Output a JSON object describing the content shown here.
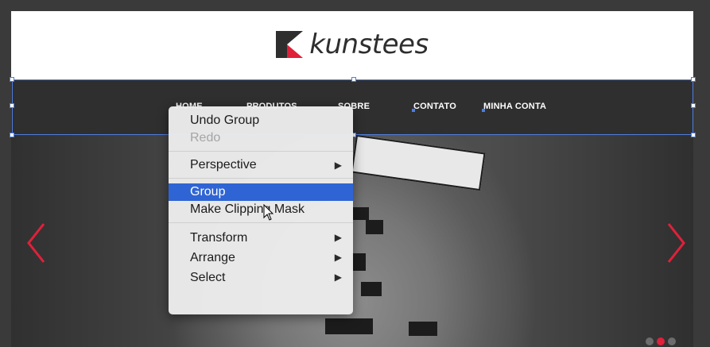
{
  "site": {
    "brand": "kunstees",
    "nav": [
      "HOME",
      "PRODUTOS",
      "SOBRE",
      "CONTATO",
      "MINHA CONTA"
    ]
  },
  "context_menu": {
    "items": [
      {
        "label": "Undo Group",
        "state": "enabled"
      },
      {
        "label": "Redo",
        "state": "disabled"
      },
      {
        "separator": true
      },
      {
        "label": "Perspective",
        "submenu": true
      },
      {
        "separator": true
      },
      {
        "label": "Group",
        "state": "highlighted"
      },
      {
        "label": "Make Clipping Mask"
      },
      {
        "separator": true
      },
      {
        "label": "Transform",
        "submenu": true
      },
      {
        "label": "Arrange",
        "submenu": true
      },
      {
        "label": "Select",
        "submenu": true
      }
    ]
  },
  "carousel": {
    "slide_count": 3,
    "active_slide": 2
  },
  "colors": {
    "brand_red": "#e0213a",
    "selection_blue": "#4f7de0",
    "menu_highlight": "#2f64d4"
  },
  "icons": {
    "submenu": "triangle-right-icon",
    "prev": "chevron-left-icon",
    "next": "chevron-right-icon",
    "cursor": "mouse-pointer-icon"
  }
}
